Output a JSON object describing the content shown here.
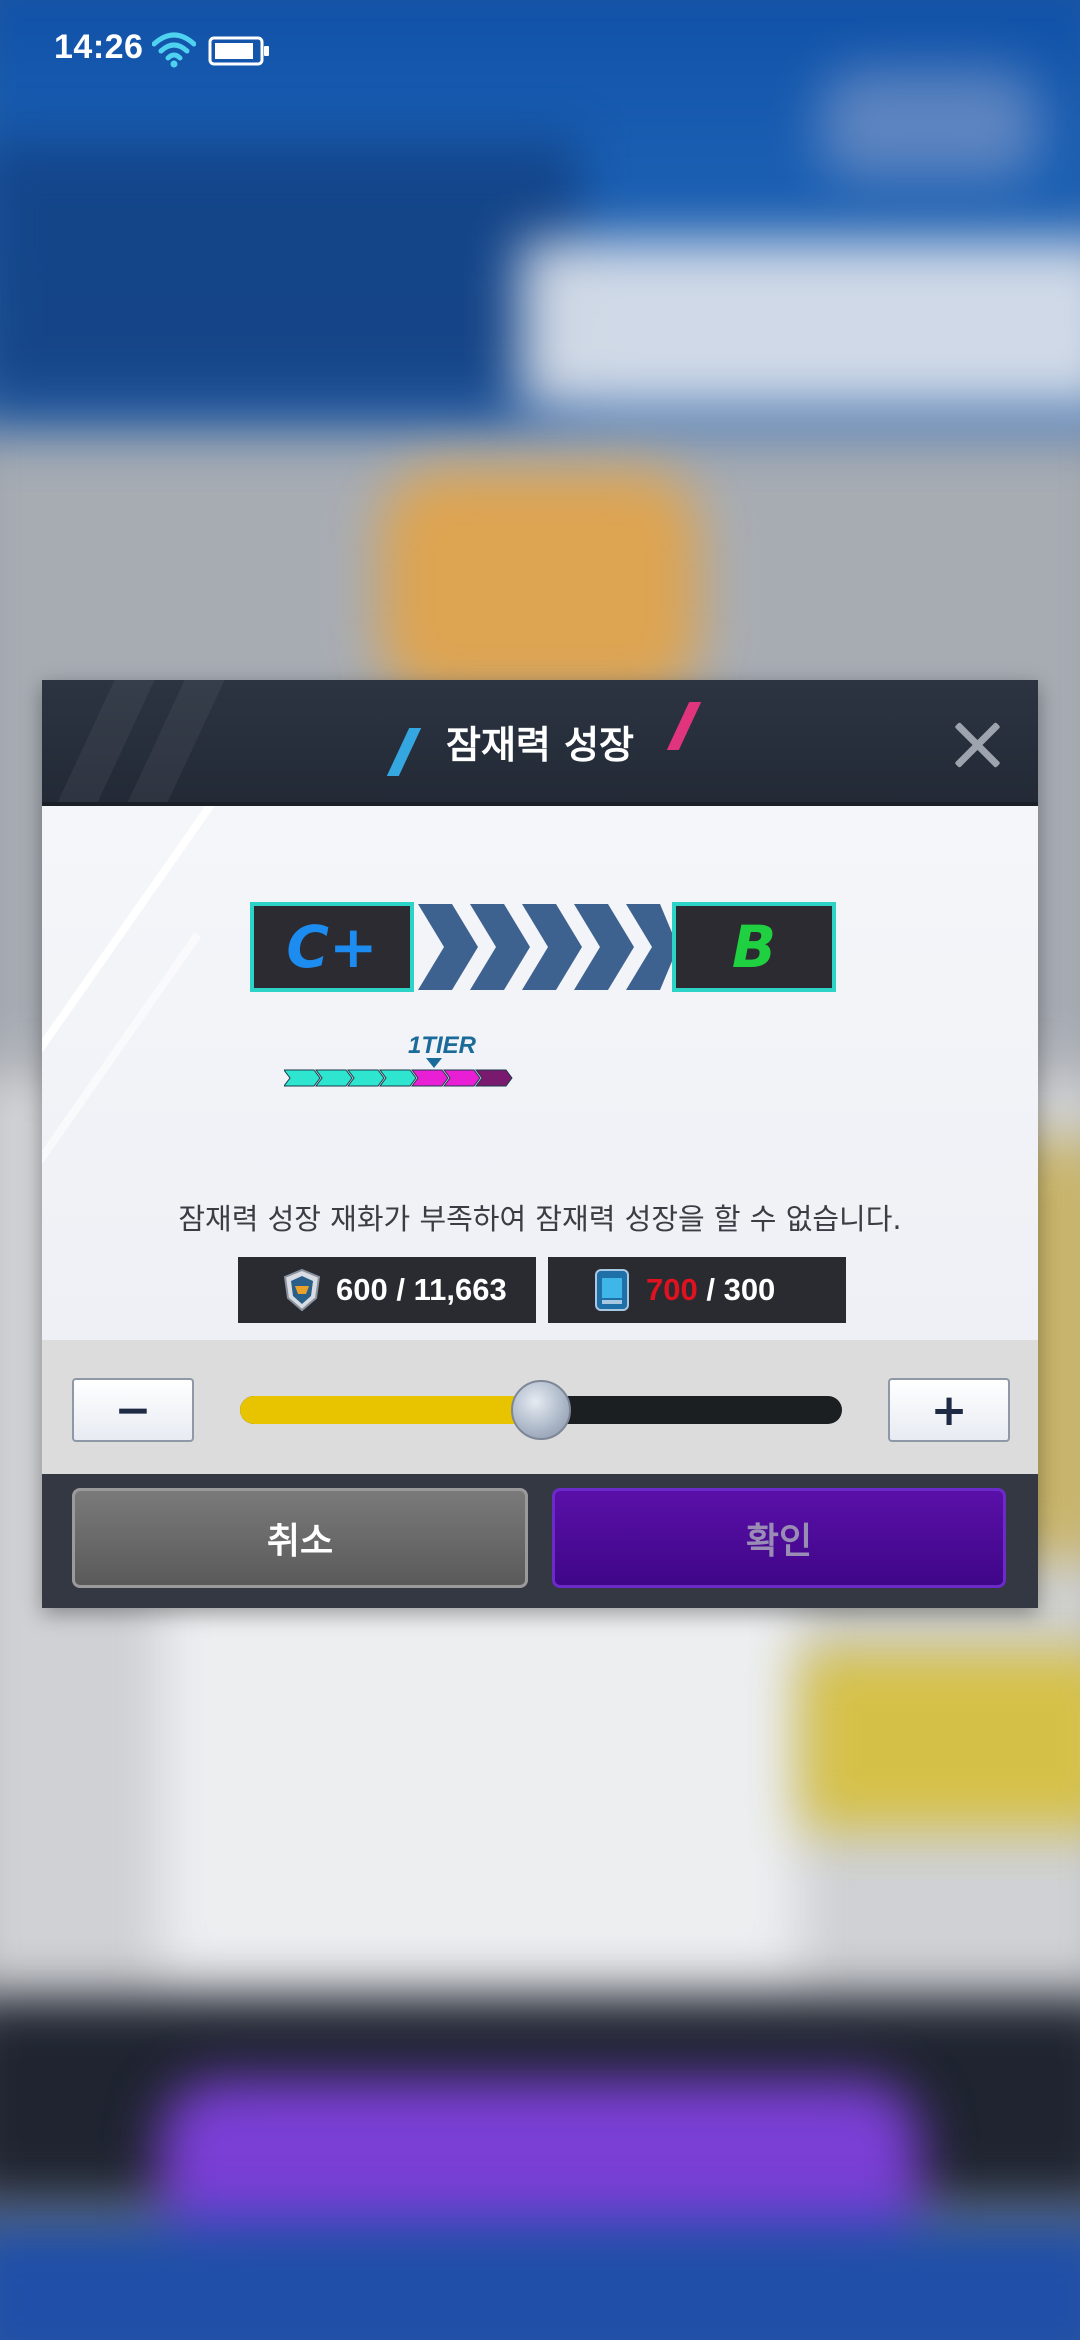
{
  "status_bar": {
    "time": "14:26",
    "wifi_icon": "wifi-icon",
    "battery_icon": "battery-icon"
  },
  "dialog": {
    "title": "잠재력 성장",
    "close_icon": "close-icon",
    "grade_from": "C+",
    "grade_to": "B",
    "tier_label": "1TIER",
    "tier": {
      "filled_cyan": 4,
      "filled_magenta": 2,
      "remaining": 1,
      "colors": {
        "cyan": "#2ee6d0",
        "magenta": "#e81fd4",
        "dark": "#7a1a6e"
      }
    },
    "message": "잠재력 성장 재화가 부족하여 잠재력 성장을 할 수 없습니다.",
    "currencies": [
      {
        "icon": "potential-medal-icon",
        "owned": "600",
        "separator": " / ",
        "required": "11,663"
      },
      {
        "icon": "blue-card-icon",
        "owned": "700",
        "separator": " / ",
        "required": "300"
      }
    ],
    "slider": {
      "minus_label": "−",
      "plus_label": "+",
      "value_fraction": 0.5,
      "fill_color": "#e8c400"
    },
    "buttons": {
      "cancel_label": "취소",
      "confirm_label": "확인"
    }
  }
}
